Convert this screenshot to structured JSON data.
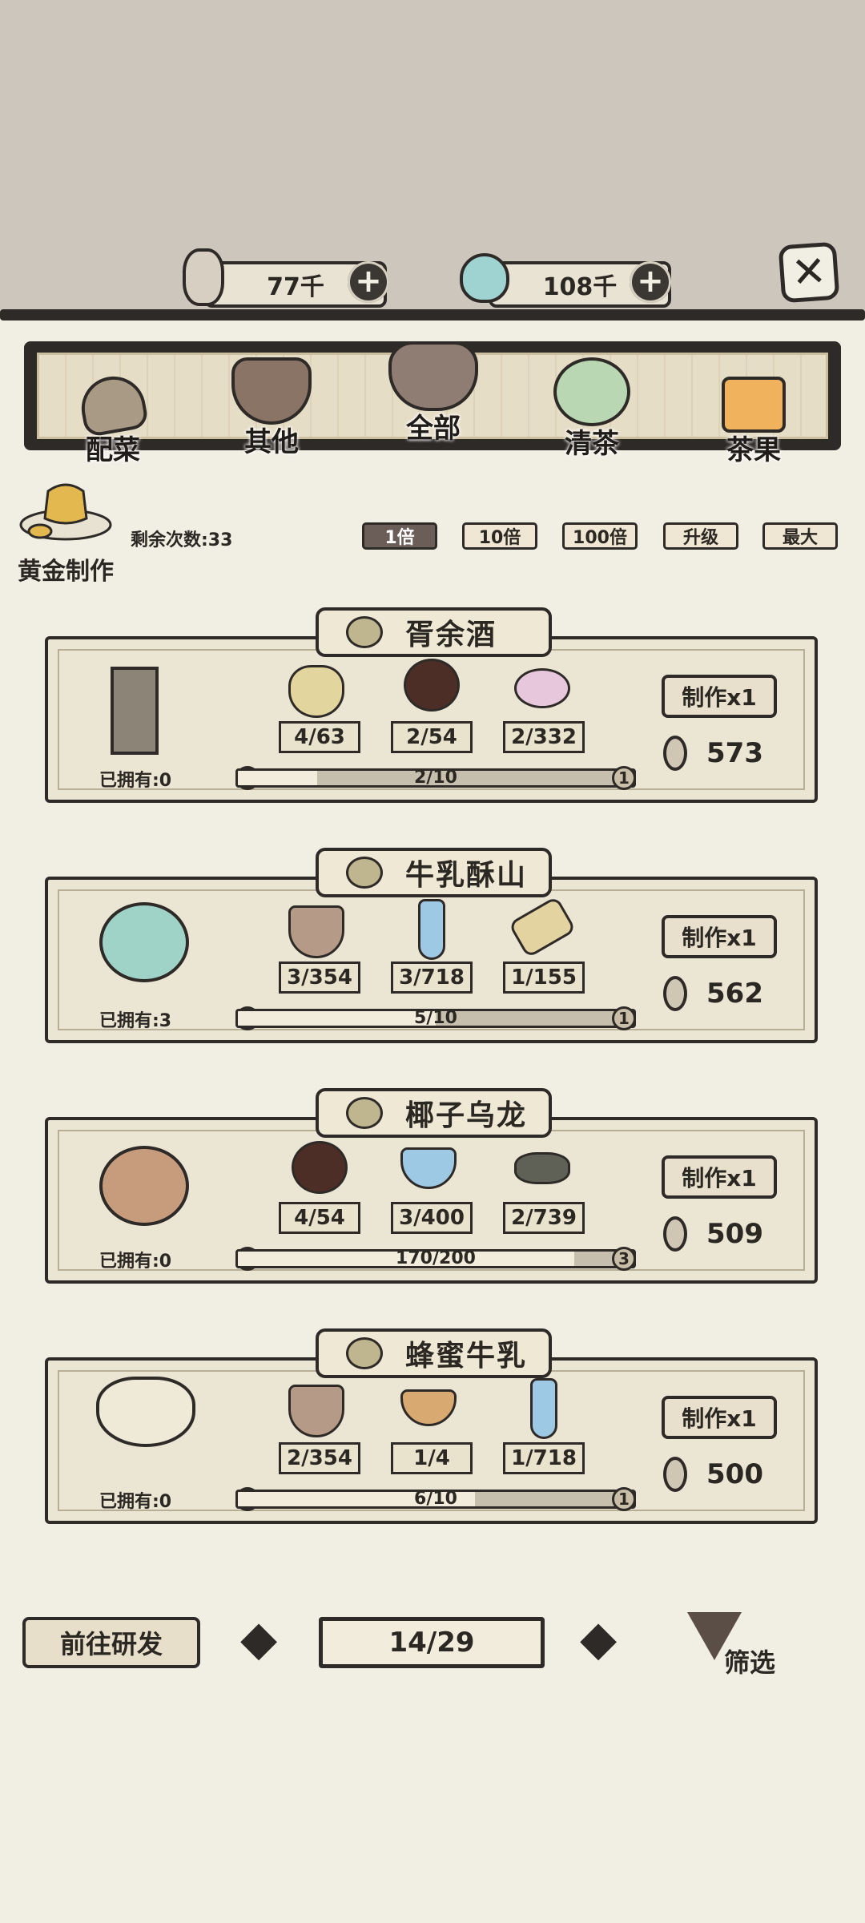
{
  "currency": {
    "coins": "77千",
    "jade": "108千",
    "add": "+",
    "close": "✕"
  },
  "categories": [
    {
      "label": "配菜",
      "active": false
    },
    {
      "label": "其他",
      "active": false
    },
    {
      "label": "全部",
      "active": true
    },
    {
      "label": "清茶",
      "active": false
    },
    {
      "label": "茶果",
      "active": false
    }
  ],
  "golden": {
    "label": "黄金制作",
    "remaining": "剩余次数:33"
  },
  "multipliers": [
    "1倍",
    "10倍",
    "100倍",
    "升级",
    "最大"
  ],
  "recipes": [
    {
      "name": "胥余酒",
      "owned": "已拥有:0",
      "ingredients": [
        {
          "icon": "bulb-icon",
          "count": "4/63"
        },
        {
          "icon": "coconut-icon",
          "count": "2/54"
        },
        {
          "icon": "flower-icon",
          "count": "2/332"
        }
      ],
      "make": "制作x1",
      "price": "573",
      "progress": {
        "from": "0",
        "to": "1",
        "text": "2/10",
        "fraction": 0.2
      }
    },
    {
      "name": "牛乳酥山",
      "owned": "已拥有:3",
      "ingredients": [
        {
          "icon": "milk-bowl-icon",
          "count": "3/354"
        },
        {
          "icon": "icicle-icon",
          "count": "3/718"
        },
        {
          "icon": "scoop-icon",
          "count": "1/155"
        }
      ],
      "make": "制作x1",
      "price": "562",
      "progress": {
        "from": "0",
        "to": "1",
        "text": "5/10",
        "fraction": 0.5
      }
    },
    {
      "name": "椰子乌龙",
      "owned": "已拥有:0",
      "ingredients": [
        {
          "icon": "coconut-icon",
          "count": "4/54"
        },
        {
          "icon": "ice-bowl-icon",
          "count": "3/400"
        },
        {
          "icon": "tea-leaf-icon",
          "count": "2/739"
        }
      ],
      "make": "制作x1",
      "price": "509",
      "progress": {
        "from": "2",
        "to": "3",
        "text": "170/200",
        "fraction": 0.85
      }
    },
    {
      "name": "蜂蜜牛乳",
      "owned": "已拥有:0",
      "ingredients": [
        {
          "icon": "milk-bowl-icon",
          "count": "2/354"
        },
        {
          "icon": "honey-bowl-icon",
          "count": "1/4"
        },
        {
          "icon": "icicle-icon",
          "count": "1/718"
        }
      ],
      "make": "制作x1",
      "price": "500",
      "progress": {
        "from": "0",
        "to": "1",
        "text": "6/10",
        "fraction": 0.6
      }
    }
  ],
  "footer": {
    "research": "前往研发",
    "page": "14/29",
    "prev": "◆",
    "next": "◆",
    "filter": "筛选"
  }
}
